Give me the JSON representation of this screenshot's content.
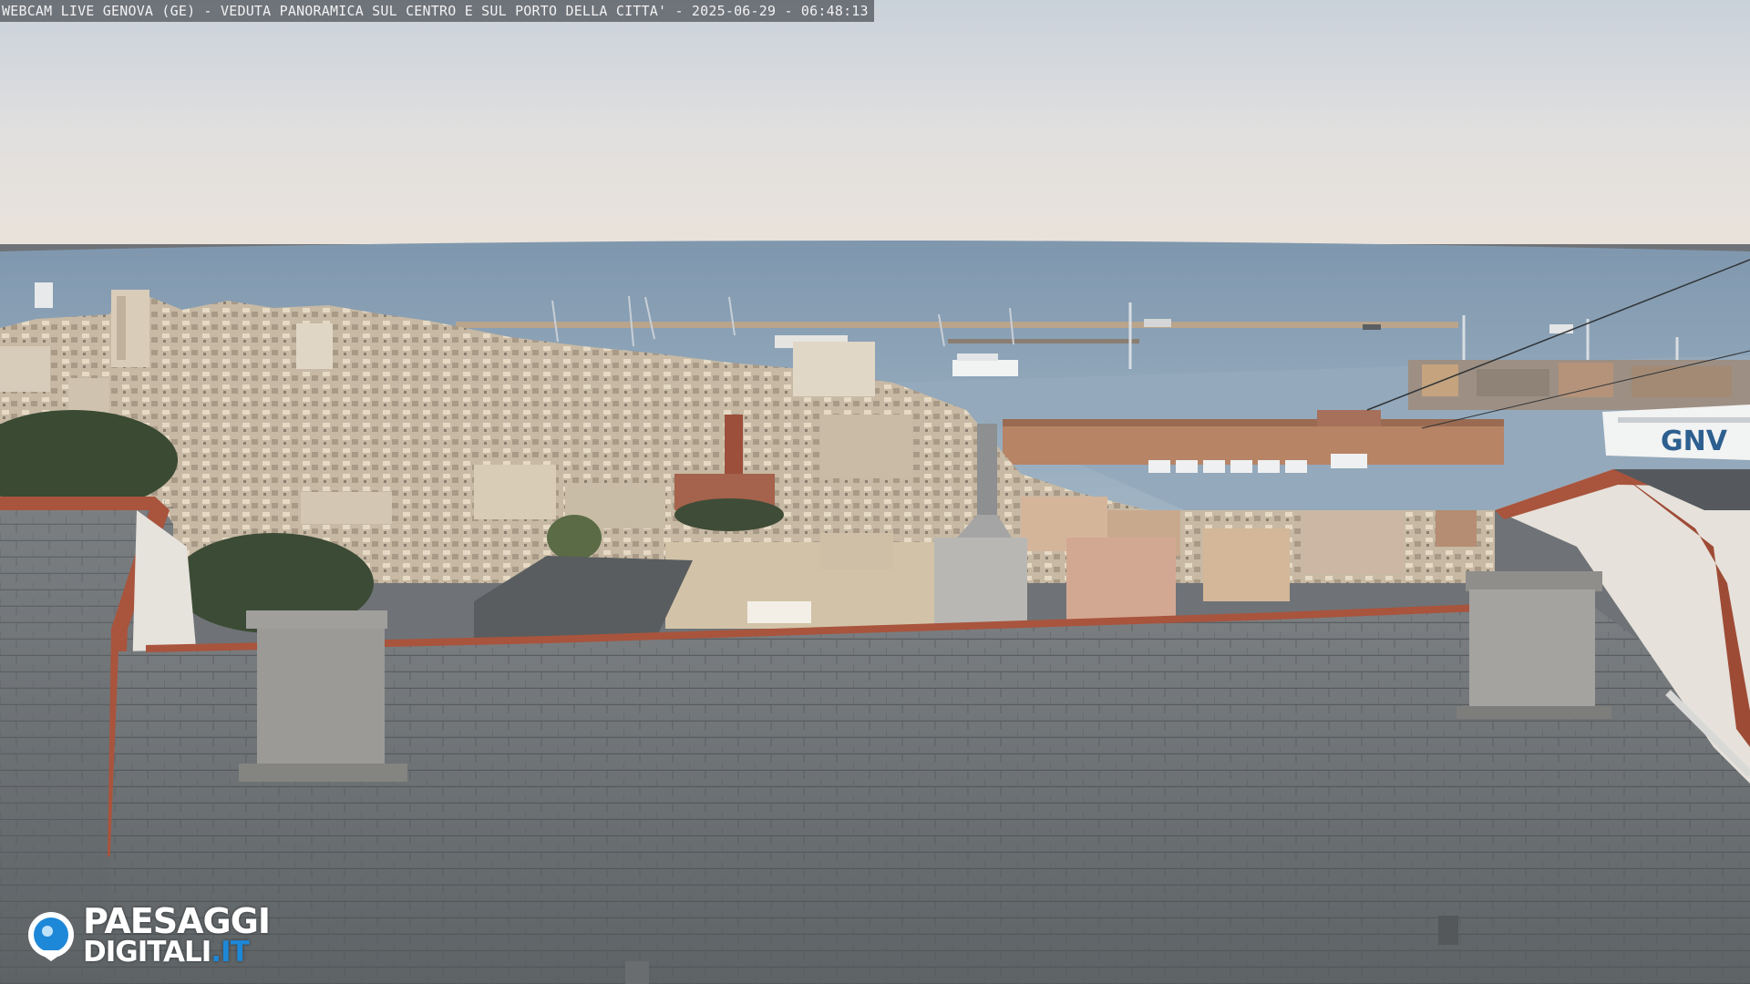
{
  "webcam": {
    "caption": "WEBCAM LIVE GENOVA (GE) - VEDUTA PANORAMICA SUL CENTRO E SUL PORTO DELLA CITTA' - 2025-06-29 - 06:48:13"
  },
  "scene": {
    "sky_color": "#dfe1e3",
    "sea_color": "#8ea3b6",
    "roof_color": "#6c7073",
    "tile_trim_color": "#b0533a",
    "ship_mark": "GNV"
  },
  "logo": {
    "line1": "PAESAGGI",
    "line2": "DIGITALI",
    "tld": ".IT",
    "accent": "#1e88d8",
    "icon": "eye-icon"
  }
}
